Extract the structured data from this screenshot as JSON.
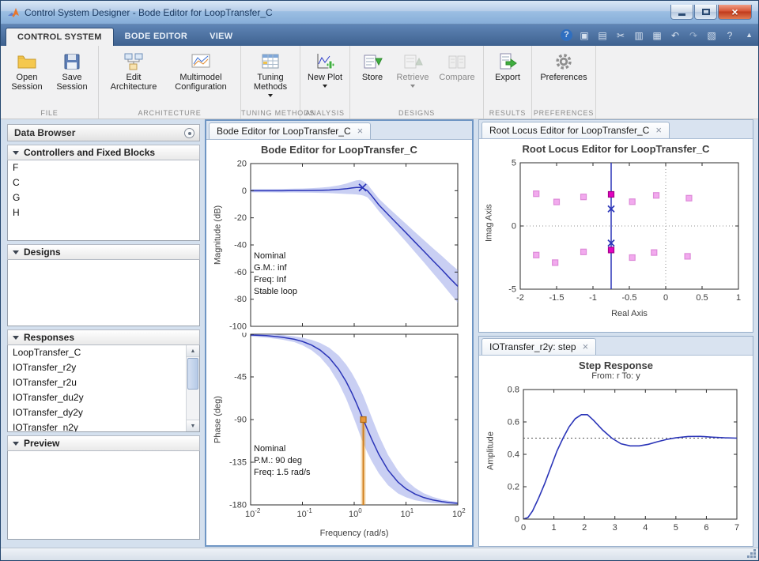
{
  "window": {
    "title": "Control System Designer - Bode Editor for LoopTransfer_C"
  },
  "colors": {
    "ribbon_blue": "#44689a",
    "active_tab_bg": "#f1f1f2",
    "plot_line_blue": "#2b35b8",
    "uncertainty_band": "#9da8ea",
    "marker_orange": "#d2801e",
    "pole_magenta": "#e203c0",
    "sample_pink": "#f2aaee"
  },
  "ribbon": {
    "tabs": [
      {
        "label": "CONTROL SYSTEM"
      },
      {
        "label": "BODE EDITOR"
      },
      {
        "label": "VIEW"
      }
    ],
    "quick_access_icons": [
      "help-badge",
      "snapshot",
      "save",
      "cut",
      "copy",
      "paste",
      "undo",
      "redo",
      "layout",
      "help",
      "collapse-ribbon"
    ]
  },
  "toolbar": {
    "groups": [
      {
        "caption": "FILE",
        "buttons": [
          {
            "label": "Open Session"
          },
          {
            "label": "Save Session"
          }
        ]
      },
      {
        "caption": "ARCHITECTURE",
        "buttons": [
          {
            "label": "Edit Architecture"
          },
          {
            "label": "Multimodel Configuration"
          }
        ]
      },
      {
        "caption": "TUNING METHODS",
        "buttons": [
          {
            "label": "Tuning Methods"
          }
        ]
      },
      {
        "caption": "ANALYSIS",
        "buttons": [
          {
            "label": "New Plot"
          }
        ]
      },
      {
        "caption": "DESIGNS",
        "buttons": [
          {
            "label": "Store"
          },
          {
            "label": "Retrieve"
          },
          {
            "label": "Compare"
          }
        ]
      },
      {
        "caption": "RESULTS",
        "buttons": [
          {
            "label": "Export"
          }
        ]
      },
      {
        "caption": "PREFERENCES",
        "buttons": [
          {
            "label": "Preferences"
          }
        ]
      }
    ]
  },
  "data_browser": {
    "title": "Data Browser",
    "sections": [
      {
        "label": "Controllers and Fixed Blocks",
        "items": [
          "F",
          "C",
          "G",
          "H"
        ]
      },
      {
        "label": "Designs",
        "items": []
      },
      {
        "label": "Responses",
        "items": [
          "LoopTransfer_C",
          "IOTransfer_r2y",
          "IOTransfer_r2u",
          "IOTransfer_du2y",
          "IOTransfer_dy2y",
          "IOTransfer_n2y"
        ]
      },
      {
        "label": "Preview",
        "items": []
      }
    ]
  },
  "panels": {
    "bode": {
      "tab": "Bode Editor for LoopTransfer_C"
    },
    "rootlocus": {
      "tab": "Root Locus Editor for LoopTransfer_C"
    },
    "step": {
      "tab": "IOTransfer_r2y: step"
    }
  },
  "chart_data": {
    "bode_magnitude": {
      "type": "line",
      "xscale": "log",
      "xlim": [
        0.01,
        100
      ],
      "ylim": [
        -100,
        20
      ],
      "margins": [
        8,
        10,
        8,
        48
      ],
      "xticks": [
        0.01,
        0.1,
        1,
        10,
        100
      ],
      "yticks": [
        20,
        0,
        -20,
        -40,
        -60,
        -80,
        -100
      ],
      "title": "Bode Editor for LoopTransfer_C",
      "ylabel": "Magnitude (dB)",
      "annotations": [
        "Nominal",
        "G.M.: inf",
        "Freq: Inf",
        "Stable loop"
      ],
      "series": [
        {
          "name": "nominal",
          "color": "#2b35b8",
          "width": 1.5,
          "x": [
            0.01,
            0.02,
            0.04,
            0.07,
            0.1,
            0.15,
            0.22,
            0.33,
            0.5,
            0.7,
            0.9,
            1.1,
            1.3,
            1.5,
            1.8,
            2.2,
            3,
            4.5,
            7,
            10,
            15,
            22,
            33,
            50,
            70,
            100
          ],
          "y": [
            0,
            0,
            0,
            0.1,
            0.1,
            0.2,
            0.3,
            0.5,
            0.9,
            1.4,
            2.0,
            2.4,
            2.4,
            1.7,
            0,
            -4,
            -10.5,
            -17.5,
            -25,
            -31,
            -38,
            -44.5,
            -51.5,
            -58.5,
            -64.5,
            -70.5
          ]
        }
      ],
      "band": {
        "color": "#9da8ea",
        "opacity": 0.55,
        "spread": [
          1.2,
          1.2,
          1.3,
          1.4,
          1.5,
          1.7,
          1.9,
          2.3,
          3,
          3.8,
          4.6,
          5.2,
          5.5,
          5.3,
          4.8,
          4.5,
          4.6,
          5.2,
          6,
          6.6,
          7.4,
          8.2,
          9.2,
          10.2,
          11,
          12
        ]
      },
      "scatter": [
        {
          "shape": "x",
          "size": 9,
          "stroke": "#2b35b8",
          "points": [
            [
              1.45,
              2.3
            ]
          ]
        }
      ]
    },
    "bode_phase": {
      "type": "line",
      "xscale": "log",
      "xlim": [
        0.01,
        100
      ],
      "ylim": [
        -180,
        0
      ],
      "margins": [
        2,
        10,
        28,
        48
      ],
      "xticks": [
        0.01,
        0.1,
        1,
        10,
        100
      ],
      "xtick_labels": "log",
      "yticks": [
        0,
        -45,
        -90,
        -135,
        -180
      ],
      "xlabel": "Frequency (rad/s)",
      "ylabel": "Phase (deg)",
      "annotations": [
        "Nominal",
        "P.M.: 90 deg",
        "Freq: 1.5 rad/s"
      ],
      "vlines": [
        {
          "x": 1.5,
          "y1": -180,
          "y2": -90,
          "color": "#e8a23a",
          "width": 6,
          "opacity": 0.35
        },
        {
          "x": 1.5,
          "y1": -180,
          "y2": -90,
          "color": "#d2801e",
          "width": 2
        }
      ],
      "series": [
        {
          "name": "nominal",
          "color": "#2b35b8",
          "width": 1.5,
          "x": [
            0.01,
            0.02,
            0.04,
            0.07,
            0.1,
            0.15,
            0.22,
            0.33,
            0.5,
            0.7,
            0.9,
            1.1,
            1.3,
            1.5,
            1.8,
            2.2,
            3,
            4.5,
            7,
            10,
            15,
            22,
            33,
            50,
            70,
            100
          ],
          "y": [
            -0.8,
            -1.5,
            -3.1,
            -5.3,
            -7.6,
            -11.4,
            -16.7,
            -24.8,
            -36.9,
            -50,
            -61.9,
            -72.5,
            -81.9,
            -90,
            -100.4,
            -111.3,
            -126.9,
            -143.3,
            -155.9,
            -163,
            -168.6,
            -172.2,
            -174.8,
            -176.6,
            -177.6,
            -178.3
          ]
        }
      ],
      "band": {
        "color": "#9da8ea",
        "opacity": 0.55,
        "spread": [
          1.5,
          2,
          2.5,
          3,
          4,
          5.5,
          7.5,
          10.5,
          14.5,
          18,
          21,
          23,
          24.5,
          25,
          24.5,
          23,
          20,
          16,
          12,
          9,
          6.5,
          4.5,
          3.2,
          2.2,
          1.8,
          1.4
        ]
      },
      "scatter": [
        {
          "shape": "square",
          "size": 7,
          "fill": "#e8973a",
          "stroke": "#b06a10",
          "points": [
            [
              1.5,
              -90
            ]
          ]
        }
      ]
    },
    "root_locus": {
      "type": "scatter",
      "xlim": [
        -2,
        1
      ],
      "ylim": [
        -5,
        5
      ],
      "margins": [
        8,
        12,
        24,
        46
      ],
      "xticks": [
        -2,
        -1.5,
        -1,
        -0.5,
        0,
        0.5,
        1
      ],
      "xtick_labels": "plain",
      "yticks": [
        -5,
        0,
        5
      ],
      "title": "Root Locus Editor for LoopTransfer_C",
      "xlabel": "Real Axis",
      "ylabel": "Imag Axis",
      "vlines": [
        {
          "x": 0,
          "color": "#909090",
          "width": 1,
          "dash": "1 3"
        },
        {
          "x": -0.75,
          "color": "#2b35b8",
          "width": 1.5
        }
      ],
      "hlines": [
        {
          "y": 0,
          "color": "#909090",
          "width": 1,
          "dash": "1 3"
        }
      ],
      "scatter": [
        {
          "shape": "square",
          "size": 7,
          "fill": "#f2aaee",
          "stroke": "#dd8ad8",
          "points": [
            [
              -1.78,
              2.55
            ],
            [
              -1.5,
              1.9
            ],
            [
              -1.13,
              2.3
            ],
            [
              -0.46,
              1.92
            ],
            [
              -0.13,
              2.42
            ],
            [
              0.32,
              2.2
            ],
            [
              -1.78,
              -2.3
            ],
            [
              -1.52,
              -2.9
            ],
            [
              -1.13,
              -2.05
            ],
            [
              -0.46,
              -2.5
            ],
            [
              -0.16,
              -2.1
            ],
            [
              0.3,
              -2.4
            ]
          ]
        },
        {
          "shape": "square",
          "size": 7,
          "fill": "#e203c0",
          "stroke": "#a30289",
          "points": [
            [
              -0.75,
              2.5
            ],
            [
              -0.75,
              -1.9
            ]
          ]
        },
        {
          "shape": "x",
          "size": 8,
          "stroke": "#2b35b8",
          "points": [
            [
              -0.75,
              1.35
            ],
            [
              -0.75,
              -1.35
            ]
          ]
        }
      ]
    },
    "step_response": {
      "type": "line",
      "xlim": [
        0,
        7
      ],
      "ylim": [
        0,
        0.8
      ],
      "margins": [
        8,
        12,
        20,
        48
      ],
      "xticks": [
        0,
        1,
        2,
        3,
        4,
        5,
        6,
        7
      ],
      "xtick_labels": "plain",
      "yticks": [
        0,
        0.2,
        0.4,
        0.6,
        0.8
      ],
      "title": "Step Response",
      "subtitle": "From: r  To: y",
      "ylabel": "Amplitude",
      "hlines": [
        {
          "y": 0.5,
          "color": "#555555",
          "width": 1,
          "dash": "2 3"
        }
      ],
      "series": [
        {
          "name": "response",
          "color": "#2b35b8",
          "width": 1.6,
          "x": [
            0,
            0.15,
            0.3,
            0.5,
            0.7,
            0.9,
            1.1,
            1.3,
            1.5,
            1.7,
            1.9,
            2.1,
            2.3,
            2.6,
            2.9,
            3.2,
            3.5,
            3.8,
            4.1,
            4.4,
            4.7,
            5,
            5.4,
            5.8,
            6.2,
            6.6,
            7
          ],
          "y": [
            0,
            0.01,
            0.05,
            0.13,
            0.22,
            0.32,
            0.42,
            0.5,
            0.57,
            0.62,
            0.645,
            0.645,
            0.61,
            0.55,
            0.5,
            0.465,
            0.452,
            0.452,
            0.462,
            0.478,
            0.492,
            0.502,
            0.51,
            0.511,
            0.506,
            0.502,
            0.5
          ]
        }
      ]
    }
  }
}
